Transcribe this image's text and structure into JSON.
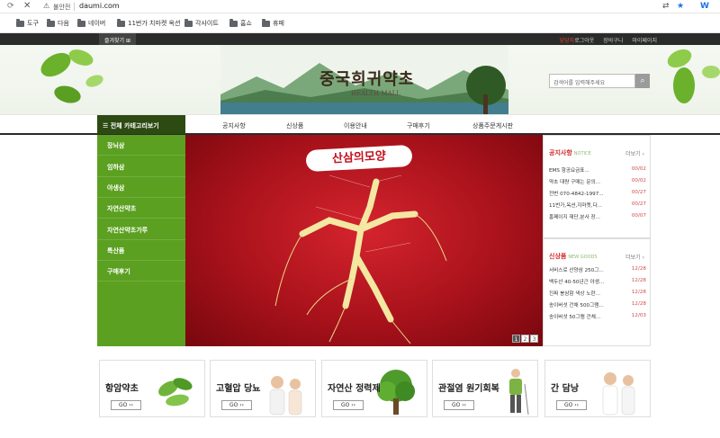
{
  "browser": {
    "insecure": "불안전",
    "url": "daumi.com"
  },
  "bookmarks": [
    {
      "label": "도구"
    },
    {
      "label": "다음"
    },
    {
      "label": "네이버"
    },
    {
      "label": "11번가 치마켓 옥션"
    },
    {
      "label": "각사이트"
    },
    {
      "label": "홈쇼"
    },
    {
      "label": "휴페"
    }
  ],
  "topbar": {
    "favorite": "즐겨찾기",
    "links": [
      {
        "label": "당당자",
        "red": true
      },
      {
        "label": "로그아웃",
        "red": false
      },
      {
        "label": "장바구니",
        "red": false
      },
      {
        "label": "마이페이지",
        "red": false
      }
    ]
  },
  "header": {
    "title": "중국희귀약초",
    "subtitle": "HEALTH MALL",
    "search_placeholder": "검색어를 입력해주세요"
  },
  "nav": {
    "category_button": "전체 카테고리보기",
    "items": [
      "공지사항",
      "신상품",
      "이용안내",
      "구매후기",
      "상품주문게시판"
    ]
  },
  "left_menu": [
    "장뇌삼",
    "임하삼",
    "야생삼",
    "자연산약초",
    "자연산약초가루",
    "특산품",
    "구매후기"
  ],
  "banner": {
    "title": "산삼의모양",
    "pages": [
      "1",
      "2",
      "3"
    ]
  },
  "notice": {
    "title": "공지사항",
    "en": "NOTICE",
    "more": "더보기",
    "rows": [
      {
        "t": "EMS 항공요금표...",
        "d": "00/02"
      },
      {
        "t": "약초 대량 구매는 문의...",
        "d": "00/02"
      },
      {
        "t": "전번 070-4842-1997...",
        "d": "00/27"
      },
      {
        "t": "11번가,옥션,지마켓,다...",
        "d": "00/27"
      },
      {
        "t": "홈페이지 재단,분사 장...",
        "d": "00/07"
      }
    ]
  },
  "new_goods": {
    "title": "신상품",
    "en": "NEW GOODS",
    "more": "더보기",
    "rows": [
      {
        "t": "서비스로 산양삼 250그...",
        "d": "12/28"
      },
      {
        "t": "백두산 40-50년근 야생...",
        "d": "12/28"
      },
      {
        "t": "진짜 봉삼함 색상 노란...",
        "d": "12/28"
      },
      {
        "t": "송이버섯 건채 500그램...",
        "d": "12/28"
      },
      {
        "t": "송이버섯 50그램 건채...",
        "d": "12/03"
      }
    ]
  },
  "cards": [
    {
      "title": "항암약초",
      "go": "GO ››"
    },
    {
      "title": "고혈압 당뇨",
      "go": "GO ››"
    },
    {
      "title": "자연산 정력제",
      "go": "GO ››"
    },
    {
      "title": "관절염 원기회복",
      "go": "GO ››"
    },
    {
      "title": "간 담낭",
      "go": "GO ››"
    }
  ],
  "colors": {
    "green": "#5ba020",
    "dark_green": "#2d4a12",
    "red": "#c3121d"
  }
}
